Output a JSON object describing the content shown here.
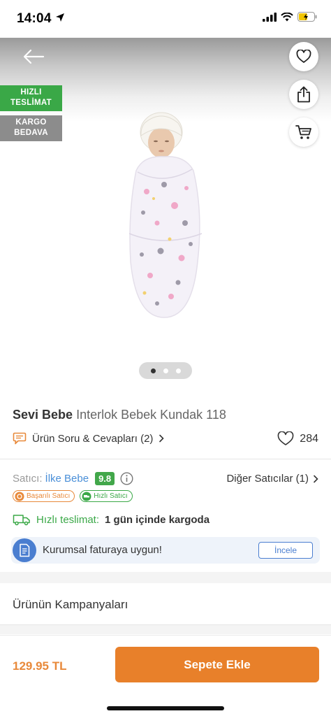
{
  "status_bar": {
    "time": "14:04"
  },
  "badges": {
    "fast_delivery": "HIZLI TESLİMAT",
    "free_shipping": "KARGO BEDAVA"
  },
  "carousel": {
    "count": 3,
    "active_index": 0
  },
  "product": {
    "brand": "Sevi Bebe",
    "name": "Interlok Bebek Kundak 118"
  },
  "qa": {
    "label": "Ürün Soru & Cevapları (2)"
  },
  "favorites": {
    "count": "284"
  },
  "seller": {
    "label": "Satıcı:",
    "name": "İlke Bebe",
    "score": "9.8",
    "other_sellers": "Diğer Satıcılar (1)",
    "tags": [
      "Başarılı Satıcı",
      "Hızlı Satıcı"
    ]
  },
  "delivery": {
    "label": "Hızlı teslimat:",
    "value": "1 gün içinde kargoda"
  },
  "invoice": {
    "text": "Kurumsal faturaya uygun!",
    "button": "İncele"
  },
  "campaigns": {
    "title": "Ürünün Kampanyaları"
  },
  "bottom": {
    "price": "129.95 TL",
    "add_to_cart": "Sepete Ekle"
  },
  "colors": {
    "accent_orange": "#e8802a",
    "green": "#3aa847",
    "link_blue": "#4a8fd8"
  }
}
